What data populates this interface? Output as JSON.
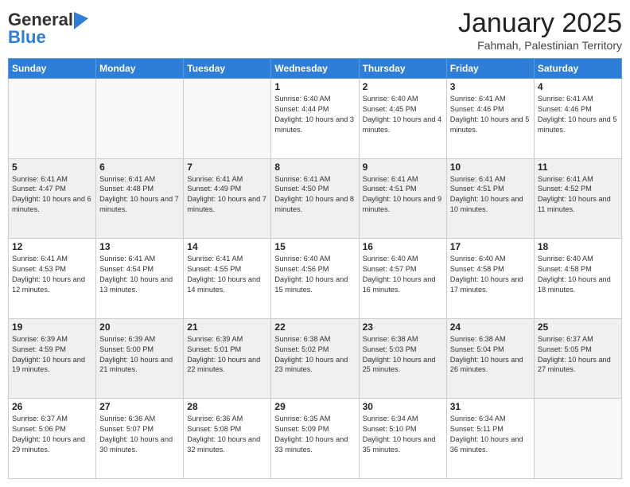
{
  "header": {
    "logo_general": "General",
    "logo_blue": "Blue",
    "month_title": "January 2025",
    "location": "Fahmah, Palestinian Territory"
  },
  "days_of_week": [
    "Sunday",
    "Monday",
    "Tuesday",
    "Wednesday",
    "Thursday",
    "Friday",
    "Saturday"
  ],
  "weeks": [
    [
      {
        "day": "",
        "info": ""
      },
      {
        "day": "",
        "info": ""
      },
      {
        "day": "",
        "info": ""
      },
      {
        "day": "1",
        "info": "Sunrise: 6:40 AM\nSunset: 4:44 PM\nDaylight: 10 hours and 3 minutes."
      },
      {
        "day": "2",
        "info": "Sunrise: 6:40 AM\nSunset: 4:45 PM\nDaylight: 10 hours and 4 minutes."
      },
      {
        "day": "3",
        "info": "Sunrise: 6:41 AM\nSunset: 4:46 PM\nDaylight: 10 hours and 5 minutes."
      },
      {
        "day": "4",
        "info": "Sunrise: 6:41 AM\nSunset: 4:46 PM\nDaylight: 10 hours and 5 minutes."
      }
    ],
    [
      {
        "day": "5",
        "info": "Sunrise: 6:41 AM\nSunset: 4:47 PM\nDaylight: 10 hours and 6 minutes."
      },
      {
        "day": "6",
        "info": "Sunrise: 6:41 AM\nSunset: 4:48 PM\nDaylight: 10 hours and 7 minutes."
      },
      {
        "day": "7",
        "info": "Sunrise: 6:41 AM\nSunset: 4:49 PM\nDaylight: 10 hours and 7 minutes."
      },
      {
        "day": "8",
        "info": "Sunrise: 6:41 AM\nSunset: 4:50 PM\nDaylight: 10 hours and 8 minutes."
      },
      {
        "day": "9",
        "info": "Sunrise: 6:41 AM\nSunset: 4:51 PM\nDaylight: 10 hours and 9 minutes."
      },
      {
        "day": "10",
        "info": "Sunrise: 6:41 AM\nSunset: 4:51 PM\nDaylight: 10 hours and 10 minutes."
      },
      {
        "day": "11",
        "info": "Sunrise: 6:41 AM\nSunset: 4:52 PM\nDaylight: 10 hours and 11 minutes."
      }
    ],
    [
      {
        "day": "12",
        "info": "Sunrise: 6:41 AM\nSunset: 4:53 PM\nDaylight: 10 hours and 12 minutes."
      },
      {
        "day": "13",
        "info": "Sunrise: 6:41 AM\nSunset: 4:54 PM\nDaylight: 10 hours and 13 minutes."
      },
      {
        "day": "14",
        "info": "Sunrise: 6:41 AM\nSunset: 4:55 PM\nDaylight: 10 hours and 14 minutes."
      },
      {
        "day": "15",
        "info": "Sunrise: 6:40 AM\nSunset: 4:56 PM\nDaylight: 10 hours and 15 minutes."
      },
      {
        "day": "16",
        "info": "Sunrise: 6:40 AM\nSunset: 4:57 PM\nDaylight: 10 hours and 16 minutes."
      },
      {
        "day": "17",
        "info": "Sunrise: 6:40 AM\nSunset: 4:58 PM\nDaylight: 10 hours and 17 minutes."
      },
      {
        "day": "18",
        "info": "Sunrise: 6:40 AM\nSunset: 4:58 PM\nDaylight: 10 hours and 18 minutes."
      }
    ],
    [
      {
        "day": "19",
        "info": "Sunrise: 6:39 AM\nSunset: 4:59 PM\nDaylight: 10 hours and 19 minutes."
      },
      {
        "day": "20",
        "info": "Sunrise: 6:39 AM\nSunset: 5:00 PM\nDaylight: 10 hours and 21 minutes."
      },
      {
        "day": "21",
        "info": "Sunrise: 6:39 AM\nSunset: 5:01 PM\nDaylight: 10 hours and 22 minutes."
      },
      {
        "day": "22",
        "info": "Sunrise: 6:38 AM\nSunset: 5:02 PM\nDaylight: 10 hours and 23 minutes."
      },
      {
        "day": "23",
        "info": "Sunrise: 6:38 AM\nSunset: 5:03 PM\nDaylight: 10 hours and 25 minutes."
      },
      {
        "day": "24",
        "info": "Sunrise: 6:38 AM\nSunset: 5:04 PM\nDaylight: 10 hours and 26 minutes."
      },
      {
        "day": "25",
        "info": "Sunrise: 6:37 AM\nSunset: 5:05 PM\nDaylight: 10 hours and 27 minutes."
      }
    ],
    [
      {
        "day": "26",
        "info": "Sunrise: 6:37 AM\nSunset: 5:06 PM\nDaylight: 10 hours and 29 minutes."
      },
      {
        "day": "27",
        "info": "Sunrise: 6:36 AM\nSunset: 5:07 PM\nDaylight: 10 hours and 30 minutes."
      },
      {
        "day": "28",
        "info": "Sunrise: 6:36 AM\nSunset: 5:08 PM\nDaylight: 10 hours and 32 minutes."
      },
      {
        "day": "29",
        "info": "Sunrise: 6:35 AM\nSunset: 5:09 PM\nDaylight: 10 hours and 33 minutes."
      },
      {
        "day": "30",
        "info": "Sunrise: 6:34 AM\nSunset: 5:10 PM\nDaylight: 10 hours and 35 minutes."
      },
      {
        "day": "31",
        "info": "Sunrise: 6:34 AM\nSunset: 5:11 PM\nDaylight: 10 hours and 36 minutes."
      },
      {
        "day": "",
        "info": ""
      }
    ]
  ]
}
